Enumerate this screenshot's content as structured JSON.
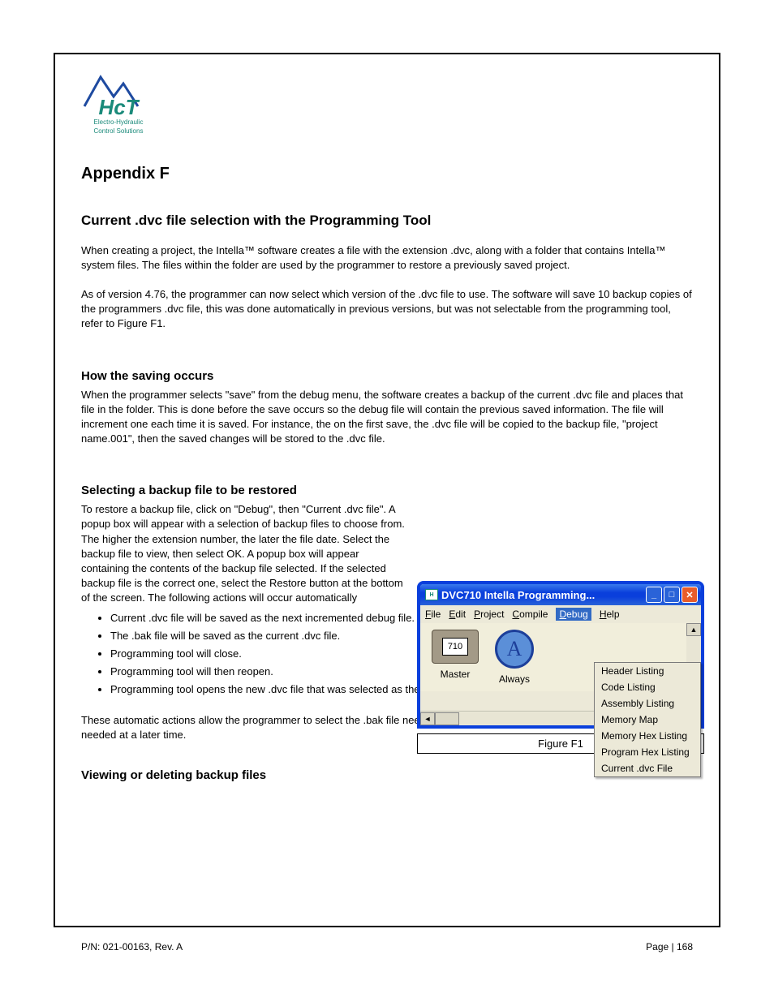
{
  "logo": {
    "line1": "Electro-Hydraulic",
    "line2": "Control Solutions",
    "abbr": "HcT"
  },
  "title": "Appendix F",
  "sec_a": {
    "heading": "Current .dvc file selection with the Programming Tool",
    "p1": "When creating a project, the Intella™ software creates a file with the extension .dvc, along with a folder that contains Intella™ system files. The files within the folder are used by the programmer to restore a previously saved project.",
    "p2": "As of version 4.76, the programmer can now select which version of the .dvc file to use. The software will save 10 backup copies of the programmers .dvc file, this was done automatically in previous versions, but was not selectable from the programming tool, refer to Figure F1."
  },
  "sec_b": {
    "heading": "How the saving occurs",
    "p1": "When the programmer selects \"save\" from the debug menu, the software creates a backup of the current .dvc file and places that file in the folder. This is done before the save occurs so the debug file will contain the previous saved information. The file will increment one each time it is saved. For instance, the on the first save, the .dvc file will be copied to the backup file, \"project name.001\", then the saved changes will be stored to the .dvc file."
  },
  "sec_c": {
    "heading": "Selecting a backup file to be restored",
    "p1": "To restore a backup file, click on \"Debug\", then \"Current .dvc file\". A popup box will appear with a selection of backup files to choose from. The higher the extension number, the later the file date. Select the backup file to view, then select OK. A popup box will appear containing the contents of the backup file selected. If the selected backup file is the correct one, select the Restore button at the bottom of the screen. The following actions will occur automatically",
    "bullets": [
      "Current .dvc file will be saved as the next incremented debug file.",
      "The .bak file will be saved as the current .dvc file.",
      "Programming tool will close.",
      "Programming tool will then reopen.",
      "Programming tool opens the new .dvc file that was selected as the .bak file."
    ],
    "p2": "These automatic actions allow the programmer to select the .bak file needed to restore as well as saving the current file in case it is needed at a later time."
  },
  "sec_d": {
    "heading": "Viewing or deleting backup files"
  },
  "figure": {
    "window_title": "DVC710 Intella Programming...",
    "menu": {
      "file": "File",
      "edit": "Edit",
      "project": "Project",
      "compile": "Compile",
      "debug": "Debug",
      "help": "Help"
    },
    "icons": {
      "master_num": "710",
      "master_label": "Master",
      "always_letter": "A",
      "always_label": "Always"
    },
    "dropdown": [
      "Header Listing",
      "Code Listing",
      "Assembly Listing",
      "Memory Map",
      "Memory Hex Listing",
      "Program Hex Listing",
      "Current .dvc File"
    ],
    "caption": "Figure F1"
  },
  "footer": {
    "left": "P/N: 021-00163, Rev. A",
    "right": "Page | 168"
  }
}
